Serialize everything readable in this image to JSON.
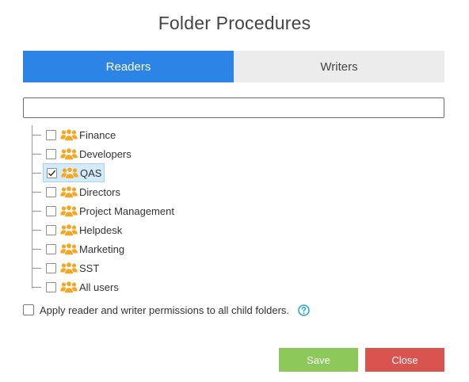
{
  "dialog": {
    "title": "Folder Procedures"
  },
  "tabs": [
    {
      "label": "Readers",
      "active": true
    },
    {
      "label": "Writers",
      "active": false
    }
  ],
  "search": {
    "value": "",
    "placeholder": ""
  },
  "groups": [
    {
      "label": "Finance",
      "checked": false,
      "selected": false,
      "icon": "group-icon"
    },
    {
      "label": "Developers",
      "checked": false,
      "selected": false,
      "icon": "group-icon"
    },
    {
      "label": "QAS",
      "checked": true,
      "selected": true,
      "icon": "group-icon"
    },
    {
      "label": "Directors",
      "checked": false,
      "selected": false,
      "icon": "group-icon"
    },
    {
      "label": "Project Management",
      "checked": false,
      "selected": false,
      "icon": "group-icon"
    },
    {
      "label": "Helpdesk",
      "checked": false,
      "selected": false,
      "icon": "group-icon"
    },
    {
      "label": "Marketing",
      "checked": false,
      "selected": false,
      "icon": "group-icon"
    },
    {
      "label": "SST",
      "checked": false,
      "selected": false,
      "icon": "group-icon"
    },
    {
      "label": "All users",
      "checked": false,
      "selected": false,
      "icon": "group-icon"
    }
  ],
  "apply_children": {
    "label": "Apply reader and writer permissions to all child folders.",
    "checked": false,
    "help_icon": "question-circle-icon"
  },
  "buttons": {
    "save_label": "Save",
    "close_label": "Close"
  },
  "colors": {
    "tab_active": "#2c84e6",
    "tab_inactive": "#ececec",
    "group_icon": "#f5a623",
    "help_icon": "#2ca8e0",
    "save": "#8cc95a",
    "close": "#d9534f",
    "selection": "#d3ebf9"
  }
}
